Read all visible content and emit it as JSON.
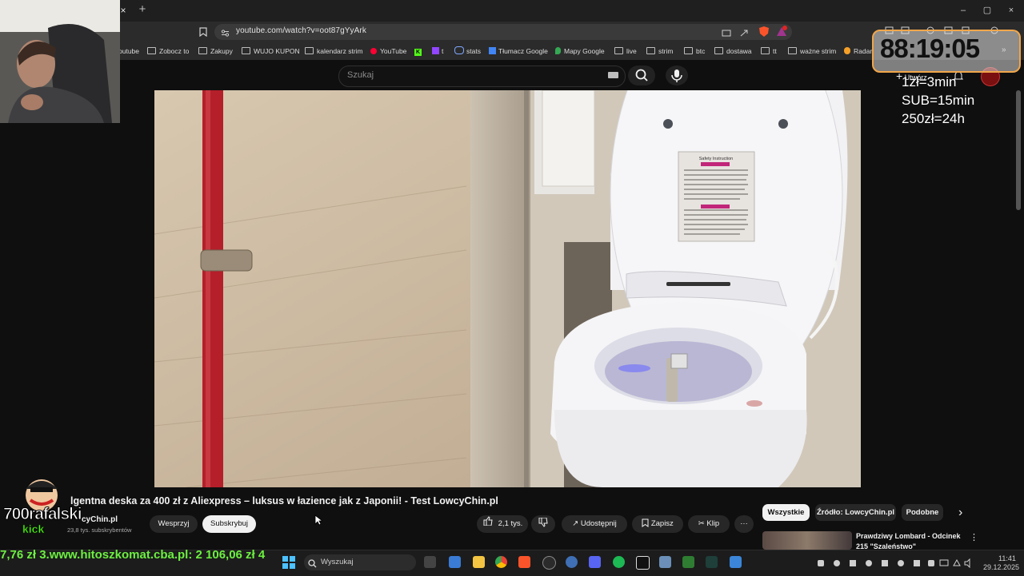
{
  "browser": {
    "url": "youtube.com/watch?v=oot87gYyArk",
    "tab_close": "×",
    "new_tab": "+",
    "window_controls": [
      "–",
      "▢",
      "×"
    ],
    "bookmarks": [
      "outube",
      "Zobocz to",
      "Zakupy",
      "WUJO KUPON",
      "kalendarz strim",
      "YouTube",
      "t",
      "stats",
      "Tłumacz Google",
      "Mapy Google",
      "live",
      "strim",
      "btc",
      "dostawa",
      "tt",
      "ważne strim",
      "Radar"
    ]
  },
  "youtube": {
    "search_placeholder": "Szukaj",
    "create_label": "Utwórz",
    "video_title": "lgentna deska za 400 zł z Aliexpress – luksus w łazience jak z Japonii! - Test LowcyChin.pl",
    "channel_name": "cyChin.pl",
    "subscribers": "23,8 tys. subskrybentów",
    "support_label": "Wesprzyj",
    "subscribe_label": "Subskrybuj",
    "likes": "2,1 tys.",
    "share_label": "Udostępnij",
    "save_label": "Zapisz",
    "clip_label": "Klip",
    "more_label": "···",
    "chips": [
      "Wszystkie",
      "Źródło: LowcyChin.pl",
      "Podobne"
    ],
    "chips_next": "›",
    "rec_title_line1": "Prawdziwy Lombard - Odcinek",
    "rec_title_line2": "215 \"Szaleństwo\"",
    "video_sign": "Safety Instruction"
  },
  "overlay": {
    "timer": "88:19:05",
    "rules": [
      "1zł=3min",
      "SUB=15min",
      "250zł=24h"
    ],
    "streamer_logo": "700rafalski",
    "kick_label": "kick",
    "ticker": "7,76 zł    3.www.hitoszkomat.cba.pl: 2 106,06 zł    4"
  },
  "taskbar": {
    "search_placeholder": "Wyszukaj",
    "time": "11:41",
    "date": "29.12.2025"
  },
  "colors": {
    "yt_bg": "#0f0f0f",
    "chip_active": "#f1f1f1",
    "ticker_green": "#6cf040",
    "timer_border": "#f0a64a",
    "kick_green": "#53fc18"
  }
}
